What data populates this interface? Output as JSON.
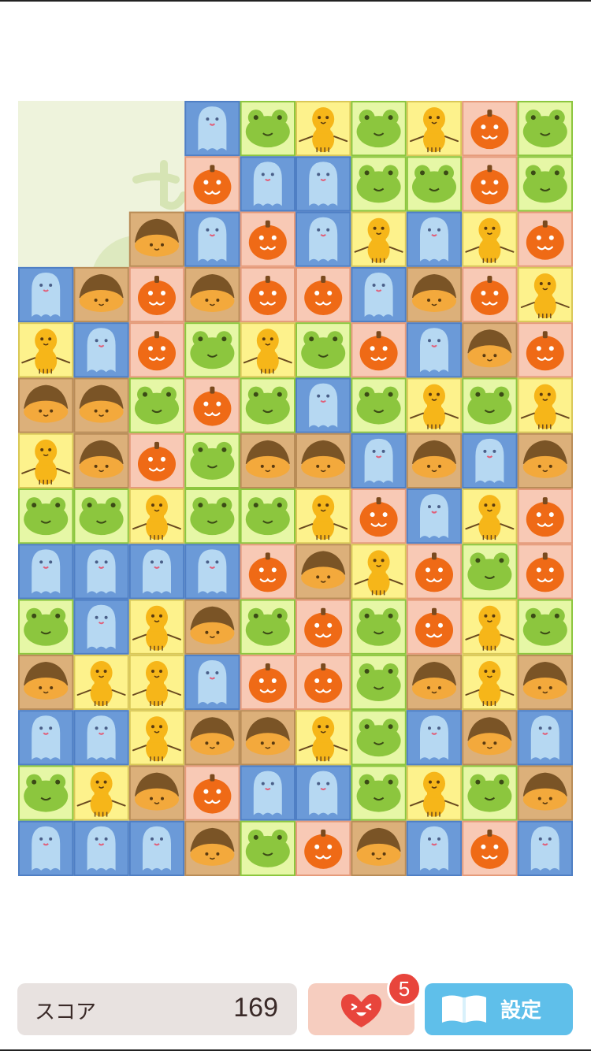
{
  "board": {
    "columns": 10,
    "rows": 14,
    "grid": [
      [
        "",
        "",
        "",
        "ghost",
        "frog",
        "peanut",
        "frog",
        "peanut",
        "pumpkin",
        "frog"
      ],
      [
        "",
        "",
        "",
        "pumpkin",
        "ghost",
        "ghost",
        "frog",
        "frog",
        "pumpkin",
        "frog"
      ],
      [
        "",
        "",
        "chestnut",
        "ghost",
        "pumpkin",
        "ghost",
        "peanut",
        "ghost",
        "peanut",
        "pumpkin"
      ],
      [
        "ghost",
        "chestnut",
        "pumpkin",
        "chestnut",
        "pumpkin",
        "pumpkin",
        "ghost",
        "chestnut",
        "pumpkin",
        "peanut"
      ],
      [
        "peanut",
        "ghost",
        "pumpkin",
        "frog",
        "peanut",
        "frog",
        "pumpkin",
        "ghost",
        "chestnut",
        "pumpkin"
      ],
      [
        "chestnut",
        "chestnut",
        "frog",
        "pumpkin",
        "frog",
        "ghost",
        "frog",
        "peanut",
        "frog",
        "peanut"
      ],
      [
        "peanut",
        "chestnut",
        "pumpkin",
        "frog",
        "chestnut",
        "chestnut",
        "ghost",
        "chestnut",
        "ghost",
        "chestnut"
      ],
      [
        "frog",
        "frog",
        "peanut",
        "frog",
        "frog",
        "peanut",
        "pumpkin",
        "ghost",
        "peanut",
        "pumpkin"
      ],
      [
        "ghost",
        "ghost",
        "ghost",
        "ghost",
        "pumpkin",
        "chestnut",
        "peanut",
        "pumpkin",
        "frog",
        "pumpkin"
      ],
      [
        "frog",
        "ghost",
        "peanut",
        "chestnut",
        "frog",
        "pumpkin",
        "frog",
        "pumpkin",
        "peanut",
        "frog"
      ],
      [
        "chestnut",
        "peanut",
        "peanut",
        "ghost",
        "pumpkin",
        "pumpkin",
        "frog",
        "chestnut",
        "peanut",
        "chestnut"
      ],
      [
        "ghost",
        "ghost",
        "peanut",
        "chestnut",
        "chestnut",
        "peanut",
        "frog",
        "ghost",
        "chestnut",
        "ghost"
      ],
      [
        "frog",
        "peanut",
        "chestnut",
        "pumpkin",
        "ghost",
        "ghost",
        "frog",
        "peanut",
        "frog",
        "chestnut"
      ],
      [
        "ghost",
        "ghost",
        "ghost",
        "chestnut",
        "frog",
        "pumpkin",
        "chestnut",
        "ghost",
        "pumpkin",
        "ghost"
      ]
    ],
    "piece_colors": {
      "ghost": {
        "bg": "#6b9ad8",
        "border": "#4f7fc4",
        "body": "#b6d8f2"
      },
      "frog": {
        "bg": "#e6f7a6",
        "border": "#8cc63e",
        "body": "#8cc63e"
      },
      "peanut": {
        "bg": "#fdf28c",
        "border": "#d9c857",
        "body": "#f6b619"
      },
      "pumpkin": {
        "bg": "#f8c9b5",
        "border": "#e59a7a",
        "body": "#ef6a16"
      },
      "chestnut": {
        "bg": "#dcb07a",
        "border": "#b98c57",
        "body": "#7a5426"
      }
    },
    "empty_area_color": "#eef3dc"
  },
  "score": {
    "label": "スコア",
    "value": "169"
  },
  "heart_button": {
    "icon": "heart-face-icon",
    "badge_count": "5",
    "color": "#e8453c"
  },
  "settings_button": {
    "label": "設定",
    "icon": "book-icon"
  }
}
